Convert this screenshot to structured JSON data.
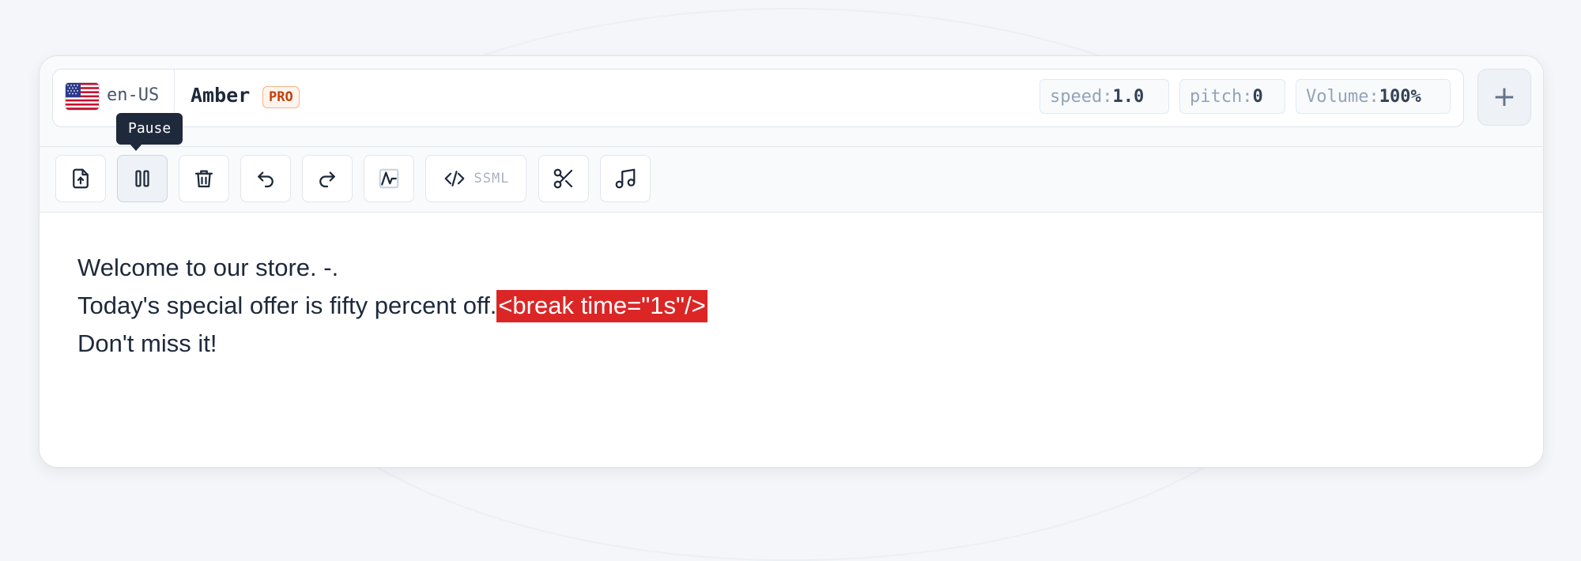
{
  "language": {
    "code": "en-US",
    "flag": "us-flag-icon"
  },
  "voice": {
    "name": "Amber",
    "badge": "PRO"
  },
  "params": [
    {
      "key": "speed:",
      "value": "1.0"
    },
    {
      "key": "pitch:",
      "value": "0"
    },
    {
      "key": "Volume:",
      "value": "100%"
    }
  ],
  "add_button": "+",
  "tooltip": "Pause",
  "toolbar": {
    "buttons": [
      {
        "name": "upload-file-button",
        "icon": "file-upload-icon"
      },
      {
        "name": "pause-button",
        "icon": "pause-icon",
        "active": true
      },
      {
        "name": "delete-button",
        "icon": "trash-icon"
      },
      {
        "name": "undo-button",
        "icon": "undo-icon"
      },
      {
        "name": "redo-button",
        "icon": "redo-icon"
      },
      {
        "name": "waveform-button",
        "icon": "waveform-icon"
      },
      {
        "name": "ssml-button",
        "icon": "code-icon",
        "label": "SSML"
      },
      {
        "name": "cut-button",
        "icon": "scissors-icon"
      },
      {
        "name": "music-button",
        "icon": "music-note-icon"
      }
    ]
  },
  "editor": {
    "line1": "Welcome to our store. -.",
    "line2_text": "Today's special offer is fifty percent off.",
    "line2_tag": "<break time=\"1s\"/>",
    "line3": "Don't miss it!"
  },
  "colors": {
    "accent_red": "#dc2626",
    "tooltip_bg": "#1e293b",
    "badge_orange": "#c2410c"
  }
}
